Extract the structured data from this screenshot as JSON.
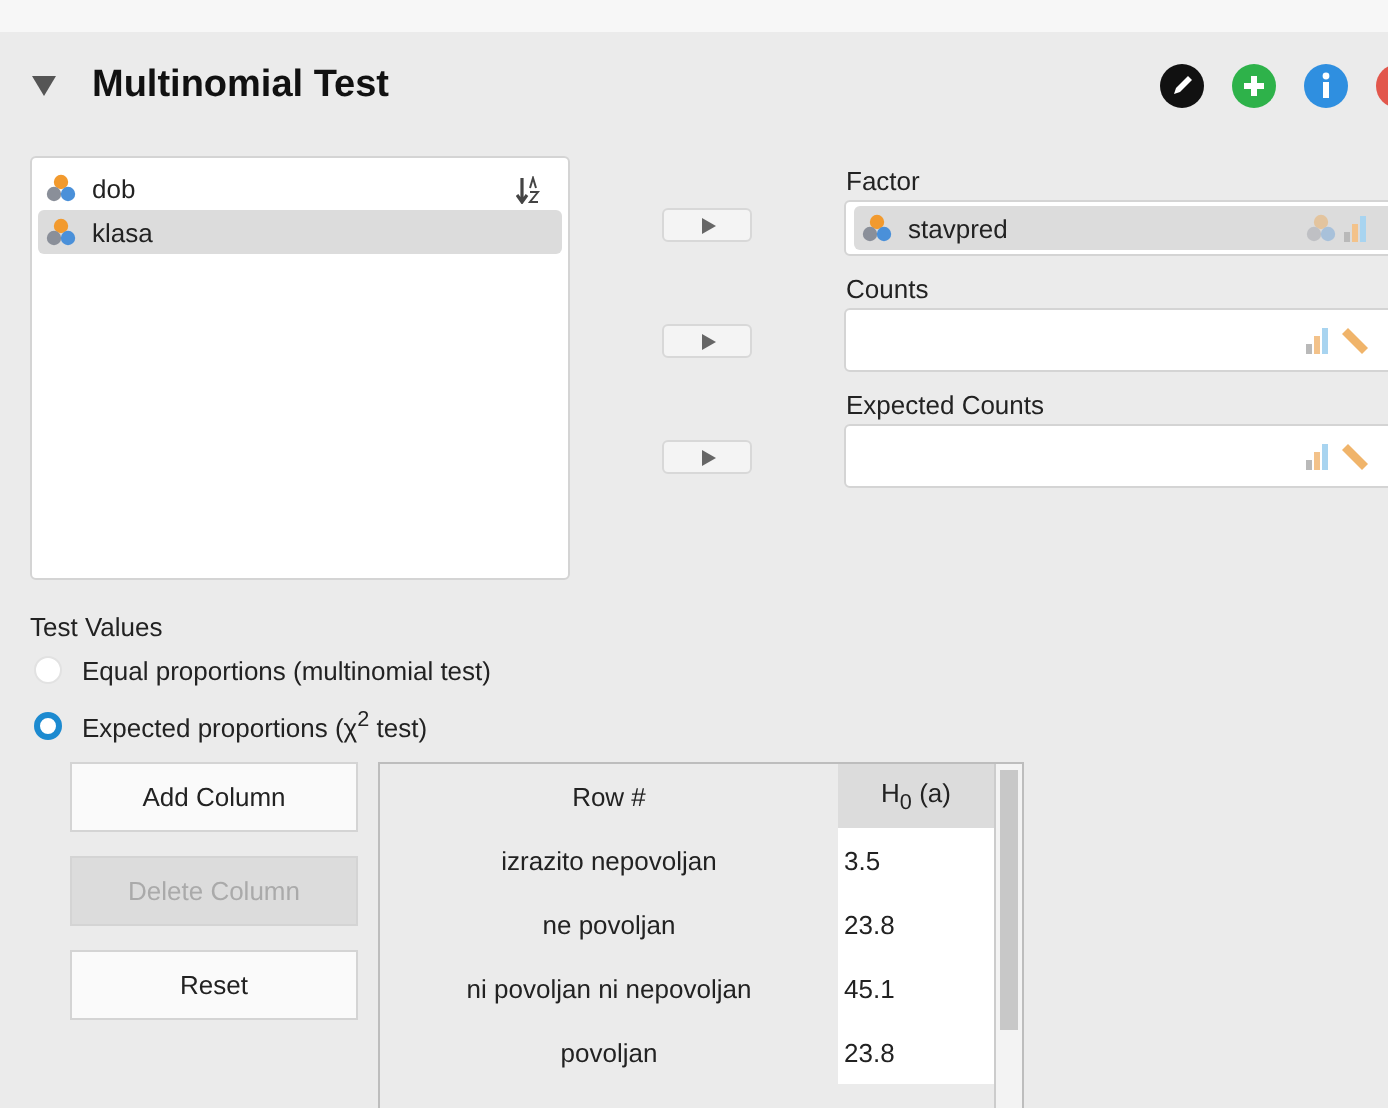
{
  "panel": {
    "title": "Multinomial Test",
    "expanded": true
  },
  "variables": [
    {
      "name": "dob",
      "selected": false
    },
    {
      "name": "klasa",
      "selected": true
    }
  ],
  "assigned": [
    {
      "label": "Factor",
      "kind": "factor",
      "variables": [
        {
          "name": "stavpred",
          "selected": true
        }
      ]
    },
    {
      "label": "Counts",
      "kind": "numeric"
    },
    {
      "label": "Expected Counts",
      "kind": "numeric"
    }
  ],
  "test_values": {
    "label": "Test Values",
    "options": [
      {
        "label": "Equal proportions (multinomial test)",
        "selected": false
      },
      {
        "label": "Expected proportions (χ$^{2}$ test)",
        "selected": true
      }
    ]
  },
  "table_buttons": [
    {
      "label": "Add Column",
      "disabled": false
    },
    {
      "label": "Delete Column",
      "disabled": true
    },
    {
      "label": "Reset",
      "disabled": false
    }
  ],
  "table": {
    "columns": [
      "Row #",
      "H$_{0}$ (a)"
    ],
    "rows": [
      [
        "izrazito nepovoljan",
        "3.5"
      ],
      [
        "ne povoljan",
        "23.8"
      ],
      [
        "ni povoljan ni nepovoljan",
        "45.1"
      ],
      [
        "povoljan",
        "23.8"
      ]
    ]
  }
}
